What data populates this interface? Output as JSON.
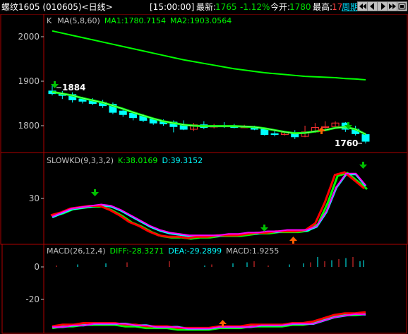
{
  "header": {
    "symbol": "螺纹1605 (010605)<日线>",
    "time": "[15:00:00]",
    "latest_label": "最新:",
    "latest_value": "1765",
    "change_pct": "-1.12%",
    "open_label": "今开:",
    "open_value": "1780",
    "high_label": "最高:",
    "high_value": "17",
    "period": "周期",
    "buttons": [
      "prev-page",
      "back",
      "forward",
      "next-page",
      "zoom"
    ]
  },
  "panels": {
    "price": {
      "prefix": "K",
      "ma_label": "MA(5,8,60)",
      "ma1": "MA1:1780.7154",
      "ma2": "MA2:1903.0564",
      "ticks": [
        "2000",
        "1900",
        "1800"
      ],
      "high_mark": "1884",
      "low_mark": "1760"
    },
    "kd": {
      "label": "SLOWKD(9,3,3,2)",
      "k": "K:38.0169",
      "d": "D:39.3152",
      "ticks": [
        "30"
      ]
    },
    "macd": {
      "label": "MACD(26,12,4)",
      "diff": "DIFF:-28.3271",
      "dea": "DEA:-29.2899",
      "macd": "MACD:1.9255",
      "ticks": [
        "0",
        "-20"
      ]
    }
  },
  "chart_data": [
    {
      "type": "candlestick",
      "title": "K  MA(5,8,60)",
      "ylim": [
        1740,
        2060
      ],
      "y_ticks": [
        2000,
        1900,
        1800
      ],
      "candles": [
        {
          "o": 1878,
          "h": 1890,
          "c": 1872,
          "l": 1868
        },
        {
          "o": 1872,
          "h": 1878,
          "c": 1868,
          "l": 1860
        },
        {
          "o": 1870,
          "h": 1875,
          "c": 1858,
          "l": 1852
        },
        {
          "o": 1860,
          "h": 1865,
          "c": 1855,
          "l": 1850
        },
        {
          "o": 1856,
          "h": 1862,
          "c": 1850,
          "l": 1846
        },
        {
          "o": 1852,
          "h": 1858,
          "c": 1845,
          "l": 1840
        },
        {
          "o": 1848,
          "h": 1852,
          "c": 1830,
          "l": 1826
        },
        {
          "o": 1833,
          "h": 1838,
          "c": 1825,
          "l": 1820
        },
        {
          "o": 1828,
          "h": 1832,
          "c": 1818,
          "l": 1812
        },
        {
          "o": 1822,
          "h": 1826,
          "c": 1812,
          "l": 1808
        },
        {
          "o": 1815,
          "h": 1818,
          "c": 1806,
          "l": 1802
        },
        {
          "o": 1810,
          "h": 1814,
          "c": 1804,
          "l": 1800
        },
        {
          "o": 1808,
          "h": 1812,
          "c": 1798,
          "l": 1785
        },
        {
          "o": 1800,
          "h": 1812,
          "c": 1792,
          "l": 1790
        },
        {
          "o": 1792,
          "h": 1806,
          "c": 1802,
          "l": 1788
        },
        {
          "o": 1802,
          "h": 1810,
          "c": 1796,
          "l": 1792
        },
        {
          "o": 1797,
          "h": 1804,
          "c": 1800,
          "l": 1794
        },
        {
          "o": 1800,
          "h": 1808,
          "c": 1798,
          "l": 1795
        },
        {
          "o": 1799,
          "h": 1804,
          "c": 1796,
          "l": 1794
        },
        {
          "o": 1797,
          "h": 1802,
          "c": 1797,
          "l": 1795
        },
        {
          "o": 1796,
          "h": 1800,
          "c": 1792,
          "l": 1790
        },
        {
          "o": 1792,
          "h": 1796,
          "c": 1780,
          "l": 1778
        },
        {
          "o": 1782,
          "h": 1790,
          "c": 1780,
          "l": 1776
        },
        {
          "o": 1780,
          "h": 1788,
          "c": 1784,
          "l": 1778
        },
        {
          "o": 1784,
          "h": 1790,
          "c": 1775,
          "l": 1770
        },
        {
          "o": 1776,
          "h": 1800,
          "c": 1786,
          "l": 1774
        },
        {
          "o": 1786,
          "h": 1806,
          "c": 1796,
          "l": 1784
        },
        {
          "o": 1796,
          "h": 1810,
          "c": 1798,
          "l": 1790
        },
        {
          "o": 1798,
          "h": 1810,
          "c": 1806,
          "l": 1796
        },
        {
          "o": 1806,
          "h": 1808,
          "c": 1792,
          "l": 1786
        },
        {
          "o": 1792,
          "h": 1800,
          "c": 1782,
          "l": 1778
        },
        {
          "o": 1780,
          "h": 1784,
          "c": 1765,
          "l": 1760
        }
      ],
      "series": [
        {
          "name": "MA1",
          "values": [
            1876,
            1872,
            1868,
            1862,
            1857,
            1852,
            1845,
            1838,
            1830,
            1823,
            1816,
            1810,
            1806,
            1802,
            1800,
            1799,
            1799,
            1799,
            1799,
            1798,
            1797,
            1794,
            1790,
            1786,
            1783,
            1784,
            1787,
            1790,
            1795,
            1797,
            1792,
            1780.7
          ]
        },
        {
          "name": "MA2",
          "values": [
            2013,
            2008,
            2003,
            1998,
            1993,
            1988,
            1983,
            1978,
            1973,
            1968,
            1963,
            1958,
            1953,
            1948,
            1944,
            1940,
            1936,
            1932,
            1928,
            1925,
            1922,
            1919,
            1917,
            1915,
            1913,
            1911,
            1910,
            1909,
            1908,
            1906,
            1905,
            1903.1
          ]
        }
      ],
      "annotations": [
        "1884",
        "1760"
      ]
    },
    {
      "type": "line",
      "title": "SLOWKD(9,3,3,2)",
      "ylim": [
        0,
        60
      ],
      "y_ticks": [
        30
      ],
      "series": [
        {
          "name": "K",
          "values": [
            18,
            20,
            23,
            24,
            25,
            25,
            22,
            18,
            13,
            10,
            6,
            3,
            2,
            2,
            1,
            2,
            2,
            3,
            3,
            3,
            4,
            5,
            5,
            6,
            6,
            6,
            7,
            12,
            28,
            48,
            50,
            44,
            38.0
          ]
        },
        {
          "name": "D",
          "values": [
            16,
            19,
            22,
            23,
            24,
            25,
            24,
            21,
            17,
            13,
            9,
            6,
            4,
            3,
            2,
            2,
            2,
            2,
            3,
            3,
            4,
            4,
            5,
            5,
            6,
            6,
            6,
            9,
            20,
            38,
            48,
            48,
            39.3
          ]
        }
      ]
    },
    {
      "type": "line",
      "title": "MACD(26,12,4)",
      "ylim": [
        -42,
        5
      ],
      "y_ticks": [
        0,
        -20
      ],
      "series": [
        {
          "name": "DIFF",
          "values": [
            -37,
            -36,
            -36,
            -35,
            -35,
            -35,
            -35,
            -36,
            -36,
            -37,
            -37,
            -37,
            -38,
            -38,
            -38,
            -38,
            -37,
            -37,
            -37,
            -36,
            -36,
            -36,
            -36,
            -35,
            -35,
            -34,
            -32,
            -30,
            -29,
            -29,
            -28.3
          ]
        },
        {
          "name": "DEA",
          "values": [
            -37,
            -37,
            -36,
            -36,
            -35,
            -35,
            -35,
            -35,
            -36,
            -36,
            -37,
            -37,
            -37,
            -38,
            -38,
            -38,
            -37,
            -37,
            -37,
            -37,
            -36,
            -36,
            -36,
            -35,
            -35,
            -35,
            -33,
            -31,
            -30,
            -29,
            -29.3
          ]
        }
      ]
    }
  ],
  "colors": {
    "border": "#b00000",
    "up": "#ff3232",
    "down": "#00ffff",
    "ma1": "#ffffff",
    "ma2": "#00ff00",
    "k": "#ff0000",
    "d": "#ff00ff",
    "header_green": "#00e000"
  }
}
